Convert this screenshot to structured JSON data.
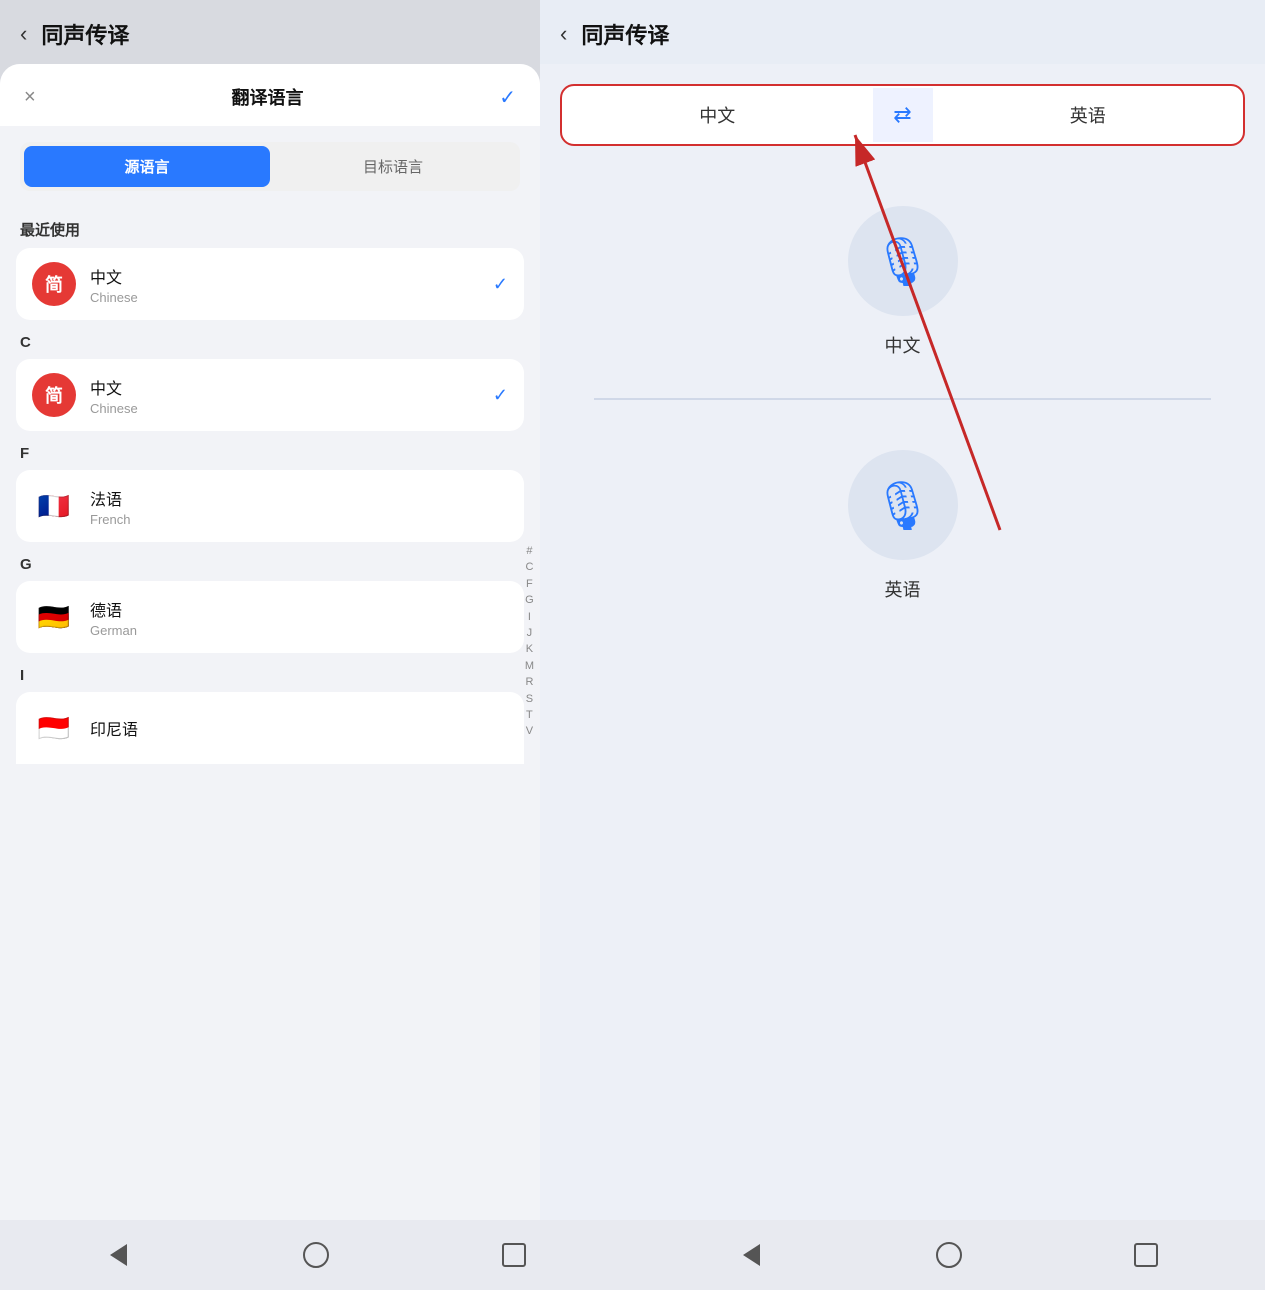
{
  "left": {
    "header": {
      "title": "同声传译",
      "back_icon": "‹"
    },
    "dialog": {
      "title": "翻译语言",
      "close": "×",
      "confirm": "✓"
    },
    "tabs": {
      "source": "源语言",
      "target": "目标语言"
    },
    "recent_label": "最近使用",
    "recent_items": [
      {
        "icon": "简",
        "name": "中文",
        "sub": "Chinese",
        "checked": true
      }
    ],
    "section_c": "C",
    "section_c_items": [
      {
        "icon": "简",
        "name": "中文",
        "sub": "Chinese",
        "checked": true
      }
    ],
    "section_f": "F",
    "section_f_items": [
      {
        "flag": "🇫🇷",
        "name": "法语",
        "sub": "French"
      }
    ],
    "section_g": "G",
    "section_g_items": [
      {
        "flag": "🇩🇪",
        "name": "德语",
        "sub": "German"
      }
    ],
    "section_i": "I",
    "section_i_items": [
      {
        "flag": "🇮🇩",
        "name": "印尼语",
        "sub": ""
      }
    ],
    "alphabet": [
      "#",
      "C",
      "F",
      "G",
      "I",
      "J",
      "K",
      "M",
      "R",
      "S",
      "T",
      "V"
    ]
  },
  "right": {
    "header": {
      "title": "同声传译",
      "back_icon": "‹"
    },
    "selector": {
      "source": "中文",
      "target": "英语",
      "swap_icon": "⇄"
    },
    "source_mic": {
      "label": "中文"
    },
    "target_mic": {
      "label": "英语"
    }
  },
  "nav": {
    "back": "◁",
    "home": "○",
    "square": "□"
  }
}
